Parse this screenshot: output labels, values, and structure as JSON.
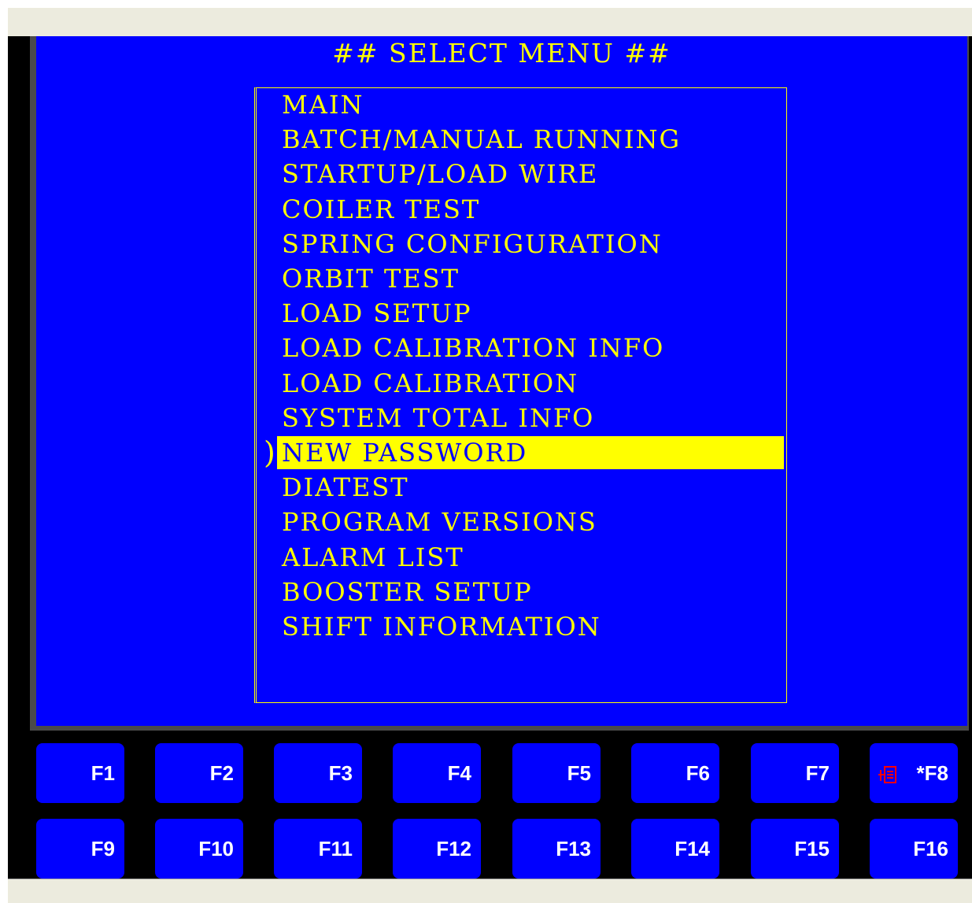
{
  "title": "## SELECT MENU ##",
  "menu": {
    "items": [
      "MAIN",
      "BATCH/MANUAL RUNNING",
      "STARTUP/LOAD WIRE",
      "COILER TEST",
      "SPRING CONFIGURATION",
      "ORBIT TEST",
      "LOAD SETUP",
      "LOAD CALIBRATION INFO",
      "LOAD CALIBRATION",
      "SYSTEM TOTAL INFO",
      "NEW PASSWORD",
      "DIATEST",
      "PROGRAM VERSIONS",
      "ALARM LIST",
      "BOOSTER SETUP",
      "SHIFT INFORMATION"
    ],
    "selected_index": 10
  },
  "function_keys": {
    "row1": [
      "F1",
      "F2",
      "F3",
      "F4",
      "F5",
      "F6",
      "F7",
      "*F8"
    ],
    "row2": [
      "F9",
      "F10",
      "F11",
      "F12",
      "F13",
      "F14",
      "F15",
      "F16"
    ],
    "f8_icon": "document-list-icon"
  },
  "colors": {
    "screen_bg": "#0000ff",
    "text": "#ffff00",
    "highlight_bg": "#ffff00",
    "highlight_text": "#0000ff",
    "key_bg": "#0000ff",
    "key_text": "#ffffff",
    "f8_icon": "#ff0000"
  }
}
